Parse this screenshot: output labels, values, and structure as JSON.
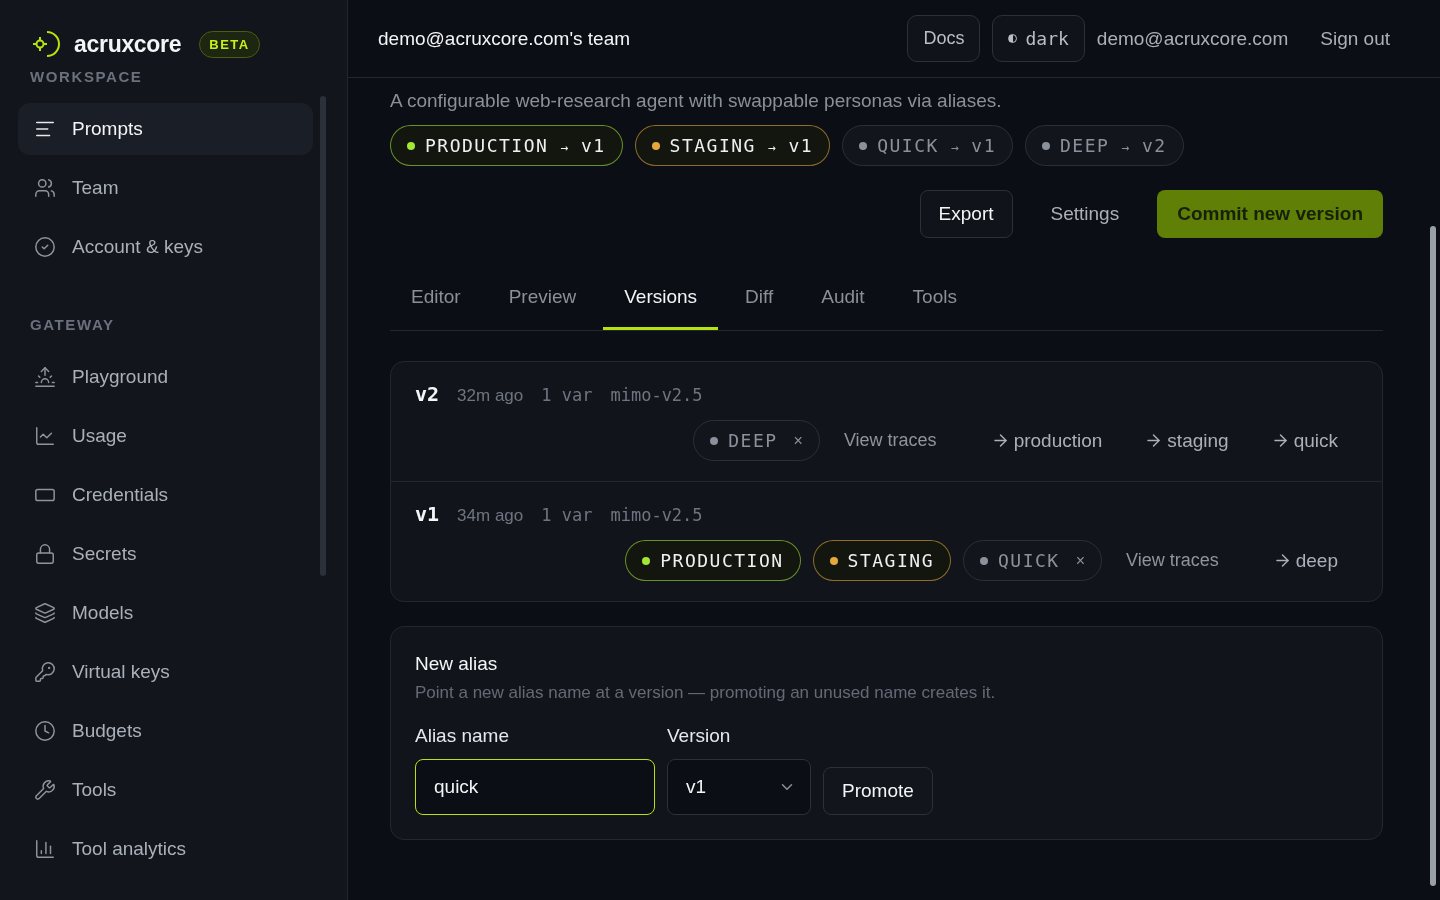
{
  "brand": {
    "name": "acruxcore",
    "badge": "BETA"
  },
  "sidebar": {
    "sections": [
      {
        "title": "WORKSPACE",
        "items": [
          {
            "label": "Prompts",
            "selected": true
          },
          {
            "label": "Team",
            "selected": false
          },
          {
            "label": "Account & keys",
            "selected": false
          }
        ]
      },
      {
        "title": "GATEWAY",
        "items": [
          {
            "label": "Playground",
            "selected": false
          },
          {
            "label": "Usage",
            "selected": false
          },
          {
            "label": "Credentials",
            "selected": false
          },
          {
            "label": "Secrets",
            "selected": false
          },
          {
            "label": "Models",
            "selected": false
          },
          {
            "label": "Virtual keys",
            "selected": false
          },
          {
            "label": "Budgets",
            "selected": false
          },
          {
            "label": "Tools",
            "selected": false
          },
          {
            "label": "Tool analytics",
            "selected": false
          }
        ]
      }
    ]
  },
  "header": {
    "team": "demo@acruxcore.com's team",
    "docs": "Docs",
    "theme": "dark",
    "email": "demo@acruxcore.com",
    "sign_out": "Sign out"
  },
  "description": "A configurable web-research agent with swappable personas via aliases.",
  "aliases": [
    {
      "name": "PRODUCTION",
      "arrow": "→",
      "version": "v1",
      "color": "#a3e635",
      "highlighted": true
    },
    {
      "name": "STAGING",
      "arrow": "→",
      "version": "v1",
      "color": "#e5a93b",
      "highlighted": true
    },
    {
      "name": "QUICK",
      "arrow": "→",
      "version": "v1",
      "color": "#8b919c",
      "highlighted": false
    },
    {
      "name": "DEEP",
      "arrow": "→",
      "version": "v2",
      "color": "#8b919c",
      "highlighted": false
    }
  ],
  "actions": {
    "export": "Export",
    "settings": "Settings",
    "commit": "Commit new version"
  },
  "tabs": [
    {
      "label": "Editor",
      "selected": false
    },
    {
      "label": "Preview",
      "selected": false
    },
    {
      "label": "Versions",
      "selected": true
    },
    {
      "label": "Diff",
      "selected": false
    },
    {
      "label": "Audit",
      "selected": false
    },
    {
      "label": "Tools",
      "selected": false
    }
  ],
  "versions": [
    {
      "version": "v2",
      "time": "32m ago",
      "vars": "1 var",
      "model": "mimo-v2.5",
      "items": [
        {
          "kind": "pill",
          "name": "DEEP",
          "color": "#8b919c",
          "highlighted": false,
          "removable": true,
          "remove": "×"
        },
        {
          "kind": "link",
          "label": "View traces"
        },
        {
          "kind": "promote",
          "label": "production"
        },
        {
          "kind": "promote",
          "label": "staging"
        },
        {
          "kind": "promote",
          "label": "quick"
        }
      ]
    },
    {
      "version": "v1",
      "time": "34m ago",
      "vars": "1 var",
      "model": "mimo-v2.5",
      "items": [
        {
          "kind": "pill",
          "name": "PRODUCTION",
          "color": "#a3e635",
          "highlighted": true,
          "removable": false
        },
        {
          "kind": "pill",
          "name": "STAGING",
          "color": "#e5a93b",
          "highlighted": true,
          "removable": false
        },
        {
          "kind": "pill",
          "name": "QUICK",
          "color": "#8b919c",
          "highlighted": false,
          "removable": true,
          "remove": "×"
        },
        {
          "kind": "link",
          "label": "View traces"
        },
        {
          "kind": "promote",
          "label": "deep"
        }
      ]
    }
  ],
  "new_alias": {
    "title": "New alias",
    "hint": "Point a new alias name at a version — promoting an unused name creates it.",
    "name_label": "Alias name",
    "name_value": "quick",
    "version_label": "Version",
    "version_value": "v1",
    "button": "Promote"
  }
}
